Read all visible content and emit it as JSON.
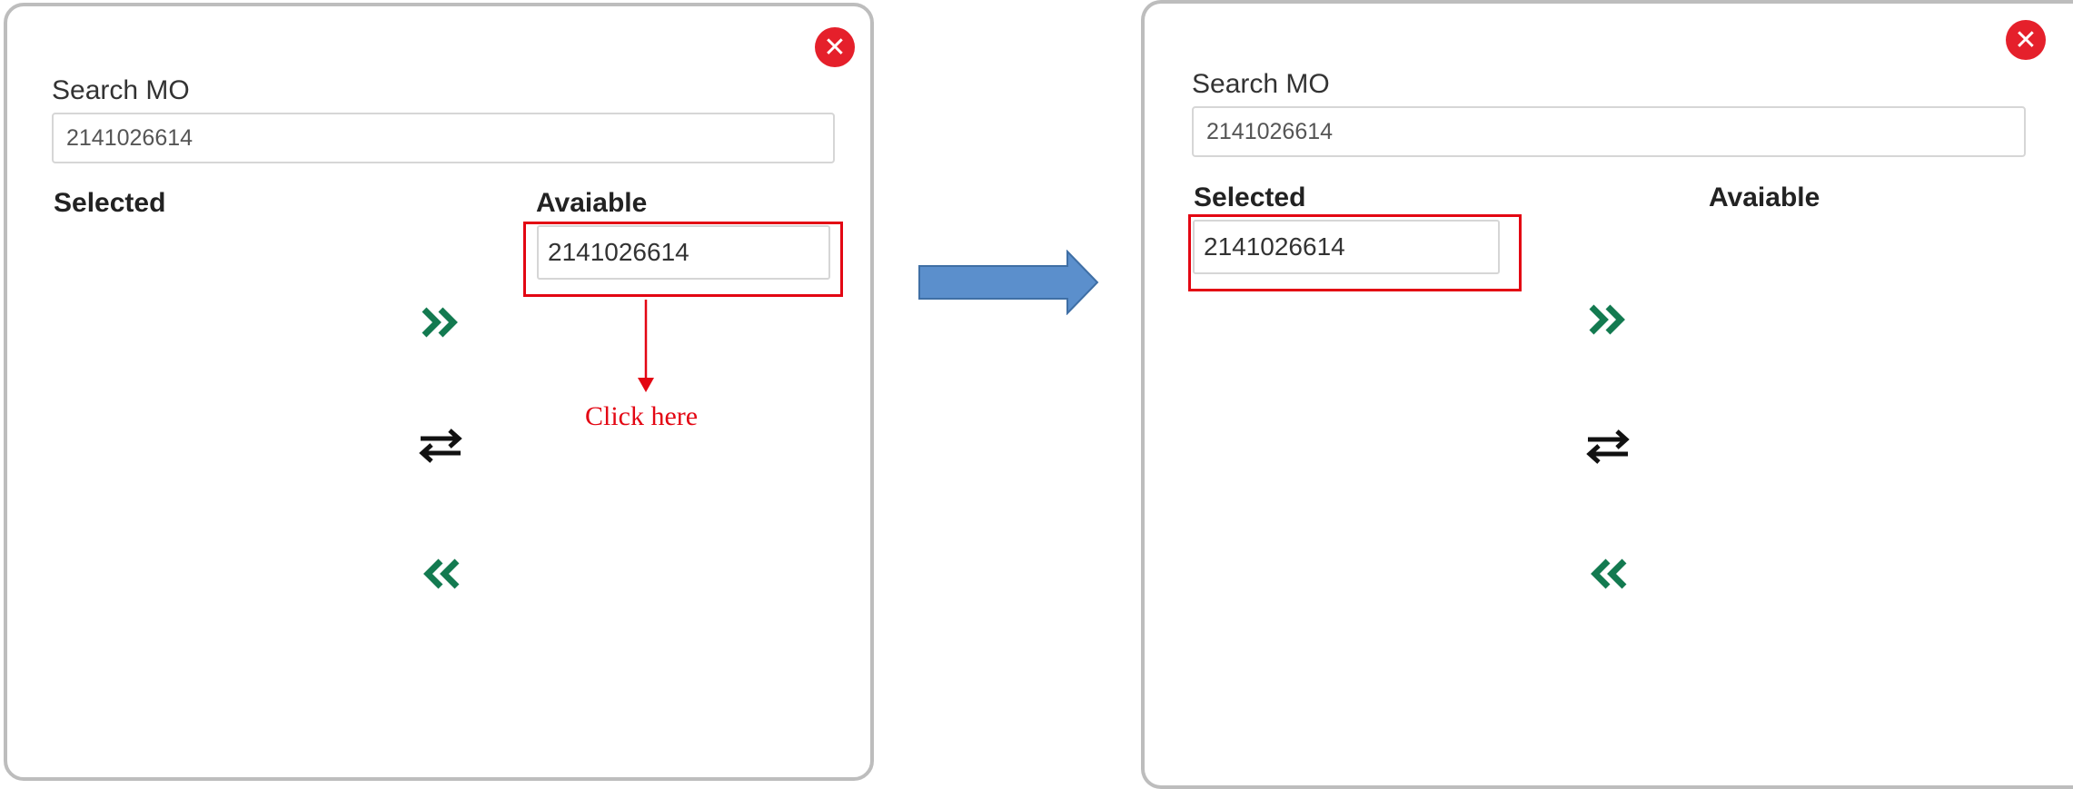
{
  "before": {
    "search_label": "Search MO",
    "search_value": "2141026614",
    "selected_heading": "Selected",
    "available_heading": "Avaiable",
    "available_items": [
      "2141026614"
    ],
    "annotation": "Click here"
  },
  "after": {
    "search_label": "Search MO",
    "search_value": "2141026614",
    "selected_heading": "Selected",
    "available_heading": "Avaiable",
    "selected_items": [
      "2141026614"
    ]
  },
  "colors": {
    "accent_green": "#137a50",
    "highlight_red": "#e30613",
    "close_red": "#e5202b",
    "arrow_blue": "#5b8fcc"
  },
  "icons": {
    "close": "close-circle-icon",
    "move_right": "double-chevron-right-icon",
    "swap": "swap-arrows-icon",
    "move_left": "double-chevron-left-icon",
    "transition": "right-arrow-icon"
  }
}
